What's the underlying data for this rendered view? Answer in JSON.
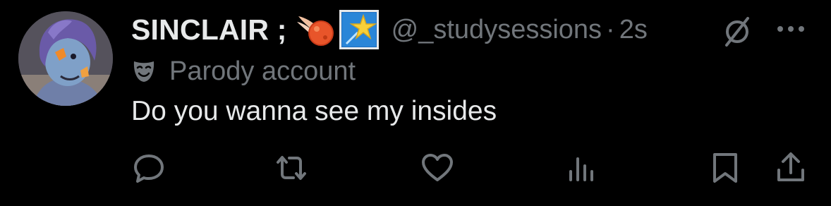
{
  "tweet": {
    "display_name": "SINCLAIR ;",
    "handle": "@_studysessions",
    "separator": "·",
    "time": "2s",
    "label": "Parody account",
    "text": "Do you wanna see my insides"
  },
  "icons": {
    "name_emoji_1": "comet-icon",
    "name_emoji_2": "star-icon",
    "label_icon": "theater-mask-icon",
    "header_right": [
      "grok-icon",
      "more-icon"
    ],
    "actions": [
      "reply-icon",
      "retweet-icon",
      "like-icon",
      "views-icon",
      "bookmark-icon",
      "share-icon"
    ]
  },
  "colors": {
    "background": "#000000",
    "primary_text": "#e7e9ea",
    "secondary_text": "#71767b"
  }
}
